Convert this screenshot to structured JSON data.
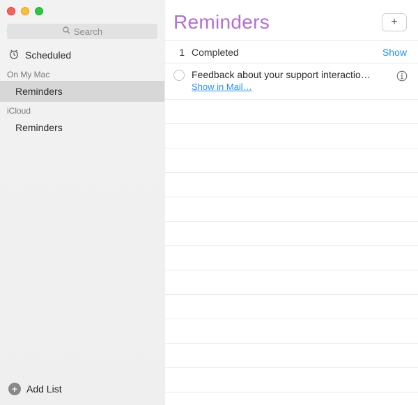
{
  "sidebar": {
    "search_placeholder": "Search",
    "scheduled_label": "Scheduled",
    "sections": [
      {
        "header": "On My Mac",
        "items": [
          {
            "label": "Reminders",
            "selected": true
          }
        ]
      },
      {
        "header": "iCloud",
        "items": [
          {
            "label": "Reminders",
            "selected": false
          }
        ]
      }
    ],
    "add_list_label": "Add List"
  },
  "main": {
    "title": "Reminders",
    "add_button_symbol": "+",
    "completed": {
      "count": "1",
      "label": "Completed",
      "show_label": "Show"
    },
    "reminders": [
      {
        "title": "Feedback about your support interactio…",
        "link_label": "Show in Mail…"
      }
    ]
  },
  "colors": {
    "accent": "#b76cd8",
    "link": "#1f8fff"
  }
}
